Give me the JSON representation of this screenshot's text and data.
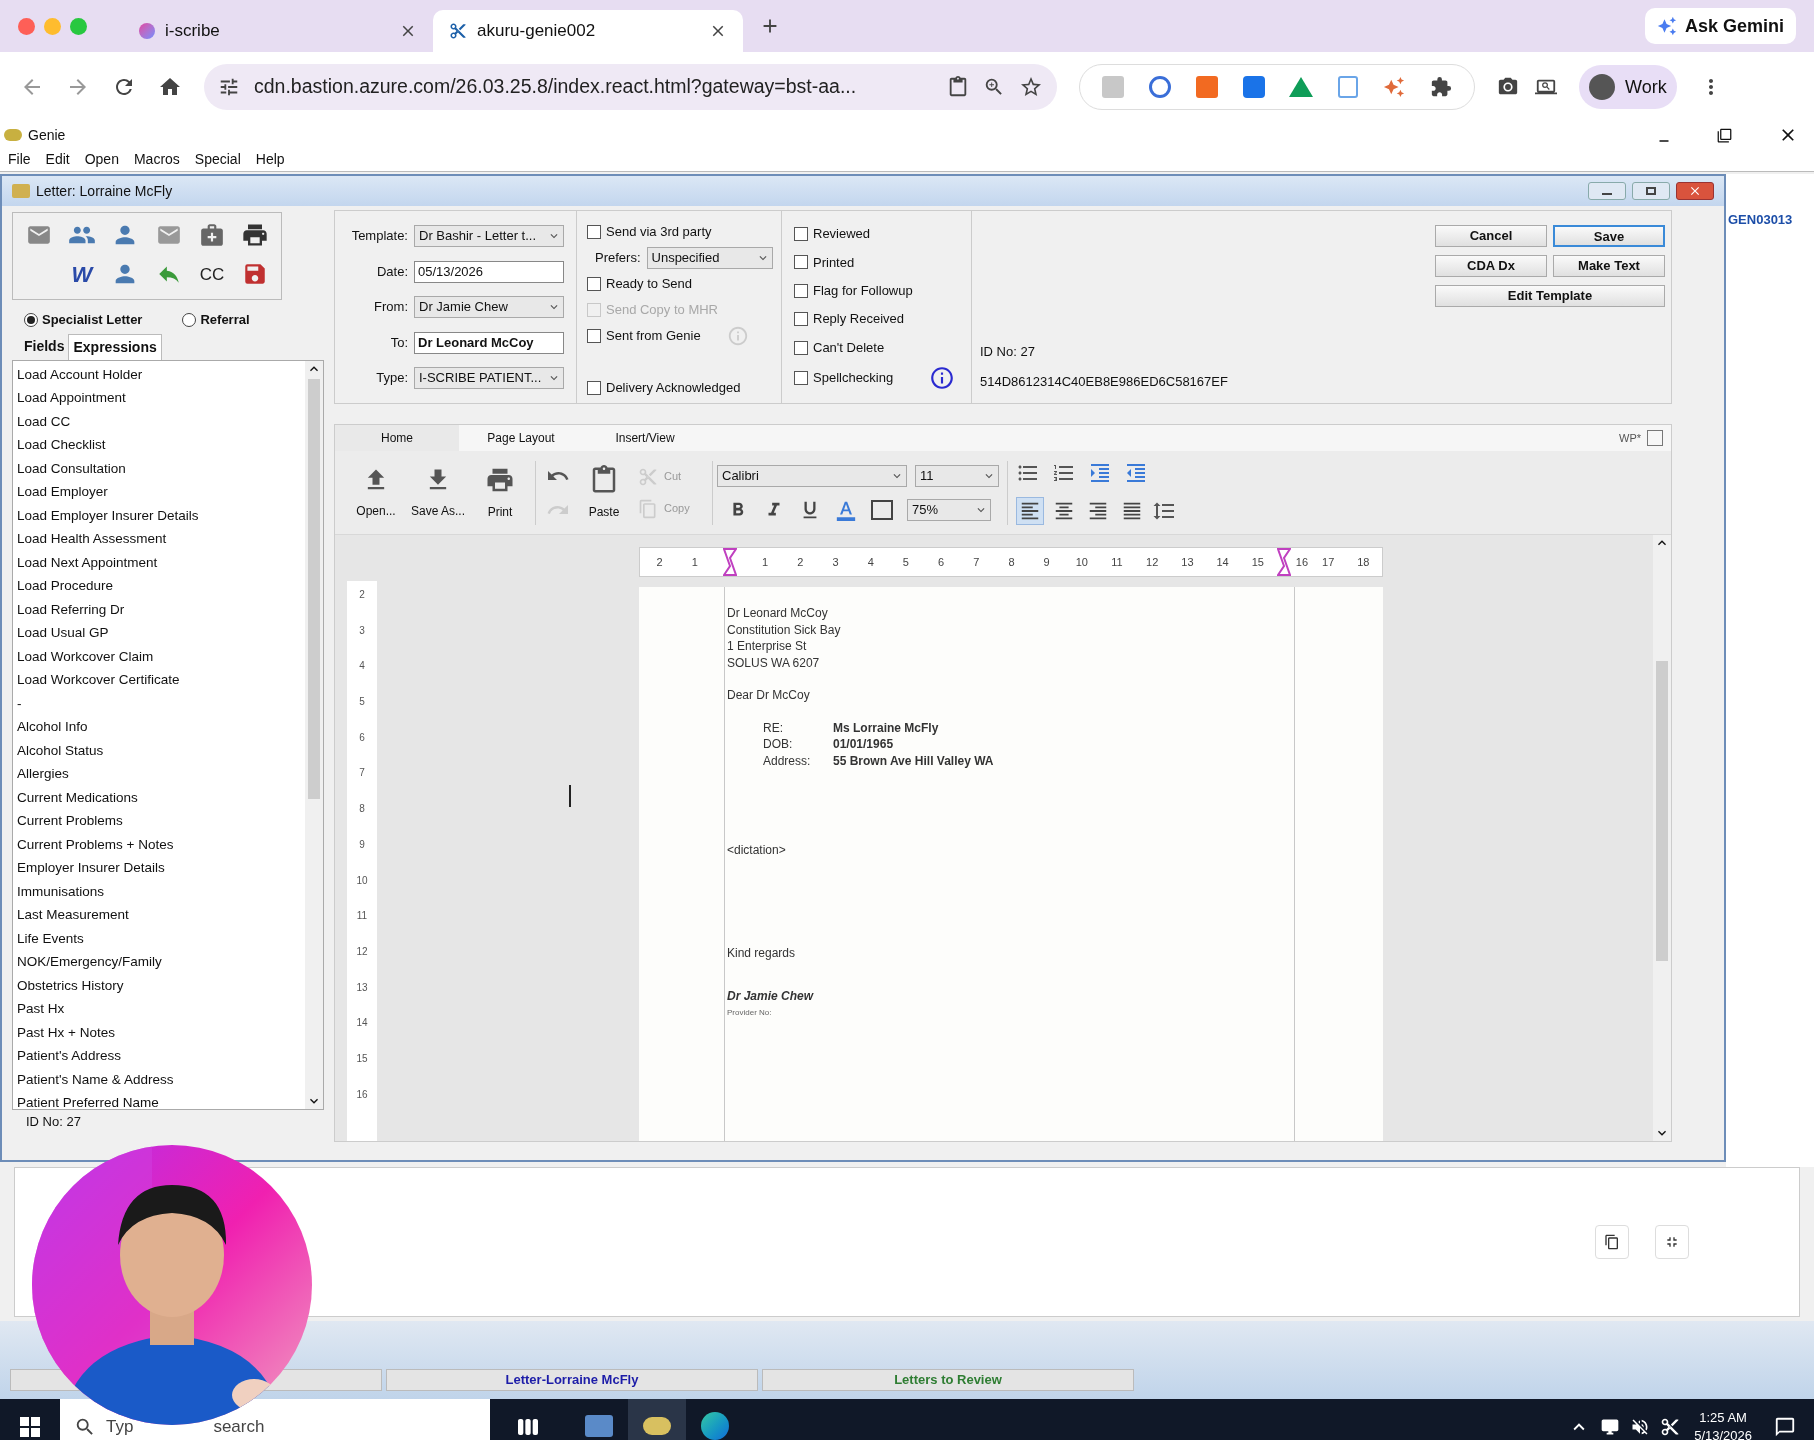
{
  "browser": {
    "tabs": [
      {
        "label": "i-scribe",
        "selected": false
      },
      {
        "label": "akuru-genie002",
        "selected": true
      }
    ],
    "url": "cdn.bastion.azure.com/26.03.25.8/index.react.html?gateway=bst-aa...",
    "ask_button": "Ask Gemini",
    "profile": "Work"
  },
  "app": {
    "title": "Genie",
    "menu": [
      "File",
      "Edit",
      "Open",
      "Macros",
      "Special",
      "Help"
    ]
  },
  "letter_window": {
    "title": "Letter: Lorraine McFly",
    "icon_letters": [
      "W",
      "CC"
    ],
    "letter_types": [
      {
        "label": "Specialist Letter",
        "selected": true
      },
      {
        "label": "Referral",
        "selected": false
      }
    ],
    "panel_tabs": [
      {
        "label": "Fields",
        "selected": false
      },
      {
        "label": "Expressions",
        "selected": true
      }
    ],
    "expressions": [
      "Load Account Holder",
      "Load Appointment",
      "Load CC",
      "Load Checklist",
      "Load Consultation",
      "Load Employer",
      "Load Employer Insurer Details",
      "Load Health Assessment",
      "Load Next Appointment",
      "Load Procedure",
      "Load Referring Dr",
      "Load Usual GP",
      "Load Workcover Claim",
      "Load Workcover Certificate",
      "-",
      "Alcohol Info",
      "Alcohol Status",
      "Allergies",
      "Current Medications",
      "Current Problems",
      "Current Problems + Notes",
      "Employer Insurer Details",
      "Immunisations",
      "Last Measurement",
      "Life Events",
      "NOK/Emergency/Family",
      "Obstetrics History",
      "Past Hx",
      "Past Hx + Notes",
      "Patient's Address",
      "Patient's Name & Address",
      "Patient Preferred Name"
    ],
    "id_footer": "ID No: 27",
    "fields": [
      {
        "label": "Template:",
        "value": "Dr Bashir - Letter t...",
        "kind": "dropdown"
      },
      {
        "label": "Date:",
        "value": "05/13/2026",
        "kind": "text"
      },
      {
        "label": "From:",
        "value": "Dr Jamie Chew",
        "kind": "dropdown"
      },
      {
        "label": "To:",
        "value": "Dr Leonard McCoy",
        "kind": "bold-text"
      },
      {
        "label": "Type:",
        "value": "I-SCRIBE PATIENT...",
        "kind": "dropdown"
      }
    ],
    "options": [
      {
        "kind": "checkbox",
        "label": "Send via 3rd party",
        "checked": false,
        "disabled": false
      },
      {
        "kind": "dropdown",
        "label": "Prefers:",
        "value": "Unspecified"
      },
      {
        "kind": "checkbox",
        "label": "Ready to Send",
        "checked": false,
        "disabled": false
      },
      {
        "kind": "checkbox",
        "label": "Send Copy to MHR",
        "checked": false,
        "disabled": true
      },
      {
        "kind": "checkbox",
        "label": "Sent from Genie",
        "checked": false,
        "disabled": false
      },
      {
        "kind": "checkbox",
        "label": "Delivery Acknowledged",
        "checked": false,
        "disabled": false
      }
    ],
    "status_checks": [
      {
        "label": "Reviewed",
        "checked": false
      },
      {
        "label": "Printed",
        "checked": false
      },
      {
        "label": "Flag for Followup",
        "checked": false
      },
      {
        "label": "Reply Received",
        "checked": false
      },
      {
        "label": "Can't Delete",
        "checked": false
      },
      {
        "label": "Spellchecking",
        "checked": false
      }
    ],
    "id_label": "ID No: 27",
    "hash": "514D8612314C40EB8E986ED6C58167EF",
    "buttons": [
      {
        "label": "Cancel",
        "selected": false
      },
      {
        "label": "Save",
        "selected": true
      },
      {
        "label": "CDA Dx",
        "selected": false
      },
      {
        "label": "Make Text",
        "selected": false
      },
      {
        "label": "Edit Template",
        "selected": false
      }
    ]
  },
  "editor": {
    "tabs": [
      {
        "label": "Home",
        "selected": true
      },
      {
        "label": "Page Layout",
        "selected": false
      },
      {
        "label": "Insert/View",
        "selected": false
      }
    ],
    "wp_label": "WP*",
    "file_tools": [
      "Open...",
      "Save As...",
      "Print"
    ],
    "paste": "Paste",
    "cut": "Cut",
    "copy": "Copy",
    "font": "Calibri",
    "size": "11",
    "zoom": "75%",
    "alignment": [
      {
        "selected": true
      },
      {
        "selected": false
      },
      {
        "selected": false
      },
      {
        "selected": false
      }
    ],
    "ruler": [
      {
        "label": "2",
        "marker": false
      },
      {
        "label": "1",
        "marker": false
      },
      {
        "marker": true
      },
      {
        "label": "1",
        "marker": false
      },
      {
        "label": "2",
        "marker": false
      },
      {
        "label": "3",
        "marker": false
      },
      {
        "label": "4",
        "marker": false
      },
      {
        "label": "5",
        "marker": false
      },
      {
        "label": "6",
        "marker": false
      },
      {
        "label": "7",
        "marker": false
      },
      {
        "label": "8",
        "marker": false
      },
      {
        "label": "9",
        "marker": false
      },
      {
        "label": "10",
        "marker": false
      },
      {
        "label": "11",
        "marker": false
      },
      {
        "label": "12",
        "marker": false
      },
      {
        "label": "13",
        "marker": false
      },
      {
        "label": "14",
        "marker": false
      },
      {
        "label": "15",
        "marker": false
      },
      {
        "label": "16",
        "marker": true
      },
      {
        "label": "17",
        "marker": false
      },
      {
        "label": "18",
        "marker": false
      }
    ],
    "vertical_ruler": [
      "2",
      "3",
      "4",
      "5",
      "6",
      "7",
      "8",
      "9",
      "10",
      "11",
      "12",
      "13",
      "14",
      "15",
      "16"
    ],
    "document": {
      "address": [
        "Dr Leonard McCoy",
        "Constitution Sick Bay",
        "1 Enterprise St",
        "SOLUS WA 6207"
      ],
      "salutation": "Dear Dr McCoy",
      "details": [
        {
          "label": "RE:",
          "value": "Ms Lorraine McFly"
        },
        {
          "label": "DOB:",
          "value": "01/01/1965"
        },
        {
          "label": "Address:",
          "value": "55 Brown Ave Hill Valley WA"
        }
      ],
      "body": "<dictation>",
      "closing": "Kind regards",
      "signature": "Dr Jamie Chew",
      "provider": "Provider No:"
    }
  },
  "background_window": {
    "code": "GEN03013"
  },
  "status_bar": [
    {
      "label": "Letter-Lorraine McFly",
      "color": "#1c1ca8"
    },
    {
      "label": "Letters to Review",
      "color": "#2e7d32"
    }
  ],
  "taskbar": {
    "search": [
      "Typ",
      "search"
    ],
    "time": "1:25 AM",
    "date": "5/13/2026"
  }
}
